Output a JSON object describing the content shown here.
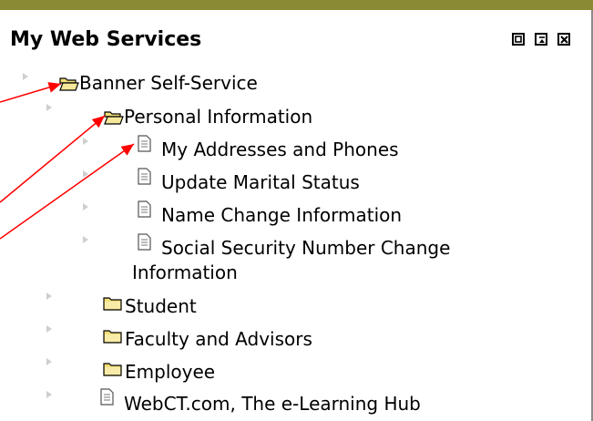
{
  "panel": {
    "title": "My Web Services",
    "window_buttons": [
      "minimize",
      "restore",
      "close"
    ]
  },
  "tree": [
    {
      "label": "Banner Self-Service",
      "icon": "folder-open-icon",
      "level": 0
    },
    {
      "label": "Personal Information",
      "icon": "folder-open-icon",
      "level": 1
    },
    {
      "label": "My Addresses and Phones",
      "icon": "document-icon",
      "level": 2
    },
    {
      "label": "Update Marital Status",
      "icon": "document-icon",
      "level": 2
    },
    {
      "label": "Name Change Information",
      "icon": "document-icon",
      "level": 2
    },
    {
      "label": "Social Security Number Change",
      "label_line2": "Information",
      "icon": "document-icon",
      "level": 2
    },
    {
      "label": "Student",
      "icon": "folder-closed-icon",
      "level": 1
    },
    {
      "label": "Faculty and Advisors",
      "icon": "folder-closed-icon",
      "level": 1
    },
    {
      "label": "Employee",
      "icon": "folder-closed-icon",
      "level": 1
    },
    {
      "label": "WebCT.com, The e-Learning Hub",
      "icon": "document-icon",
      "level": 1
    }
  ],
  "colors": {
    "top_bar": "#8b8a34",
    "annotation_arrows": "#ff0000",
    "folder_yellow": "#f3de7a"
  }
}
